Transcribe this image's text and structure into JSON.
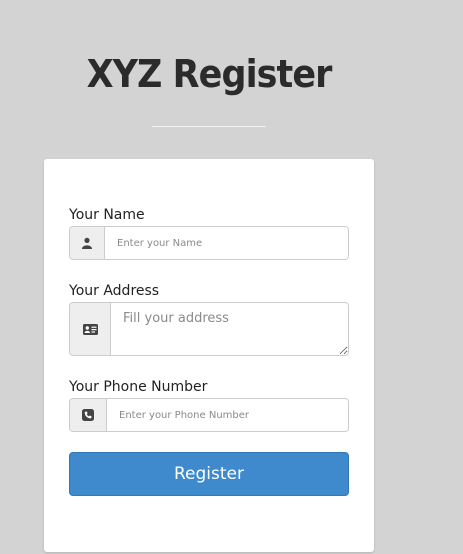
{
  "page": {
    "title": "XYZ Register"
  },
  "form": {
    "name": {
      "label": "Your Name",
      "placeholder": "Enter your Name",
      "icon": "user-icon"
    },
    "address": {
      "label": "Your Address",
      "placeholder": "Fill your address",
      "icon": "address-card-icon"
    },
    "phone": {
      "label": "Your Phone Number",
      "placeholder": "Enter your Phone Number",
      "icon": "phone-icon"
    },
    "submit_label": "Register"
  },
  "colors": {
    "background": "#d3d3d3",
    "card": "#ffffff",
    "primary_button": "#3e8acc",
    "title_text": "#2b2b2b"
  }
}
